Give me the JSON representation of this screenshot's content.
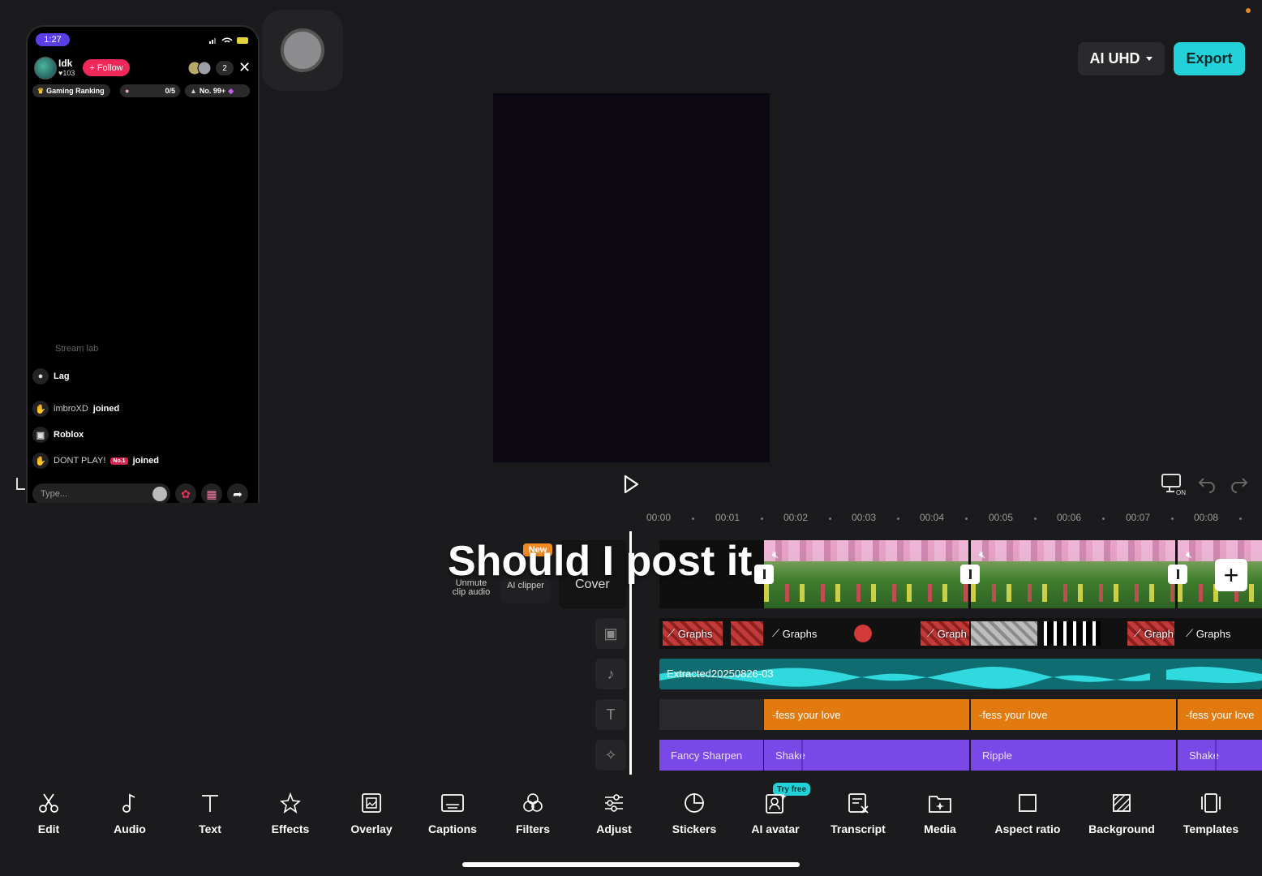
{
  "header": {
    "quality_label": "AI UHD",
    "export_label": "Export"
  },
  "preview": {
    "time_left": "00"
  },
  "phone": {
    "time": "1:27",
    "profile_name": "Idk",
    "likes": "103",
    "follow_label": "+ Follow",
    "viewer_count": "2",
    "ranking_label": "Gaming Ranking",
    "goal_value": "0/5",
    "rank_label": "No. 99+",
    "chat": [
      {
        "name": "Stream lab",
        "text": ""
      },
      {
        "name": "Lag",
        "text": ""
      },
      {
        "name": "imbroXD",
        "text": "joined"
      },
      {
        "name": "Roblox",
        "text": ""
      },
      {
        "name": "DONT PLAY!",
        "badge": "No.1",
        "text": "joined"
      }
    ],
    "input_placeholder": "Type..."
  },
  "timeline": {
    "ruler": [
      "00:00",
      "00:01",
      "00:02",
      "00:03",
      "00:04",
      "00:05",
      "00:06",
      "00:07",
      "00:08"
    ],
    "caption_text": "Should I post it",
    "new_badge": "New",
    "unmute_label": "Unmute\nclip audio",
    "ai_clipper_label": "AI clipper",
    "cover_label": "Cover",
    "overlay_clips": [
      "Graphs",
      "Graphs",
      "Graph",
      "Graph",
      "Graphs"
    ],
    "audio_label": "Extracted20250826-03",
    "text_clips": [
      "-fess your love",
      "-fess your love",
      "-fess your love"
    ],
    "effect_clips": [
      "Fancy Sharpen",
      "Shake",
      "Ripple",
      "Shake"
    ]
  },
  "toolbar": {
    "try_free": "Try free",
    "items": [
      {
        "label": "Edit",
        "icon": "scissors-icon"
      },
      {
        "label": "Audio",
        "icon": "music-note-icon"
      },
      {
        "label": "Text",
        "icon": "text-icon"
      },
      {
        "label": "Effects",
        "icon": "sparkle-icon"
      },
      {
        "label": "Overlay",
        "icon": "overlay-icon"
      },
      {
        "label": "Captions",
        "icon": "captions-icon"
      },
      {
        "label": "Filters",
        "icon": "filters-icon"
      },
      {
        "label": "Adjust",
        "icon": "sliders-icon"
      },
      {
        "label": "Stickers",
        "icon": "sticker-icon"
      },
      {
        "label": "AI avatar",
        "icon": "avatar-icon"
      },
      {
        "label": "Transcript",
        "icon": "transcript-icon"
      },
      {
        "label": "Media",
        "icon": "media-icon"
      },
      {
        "label": "Aspect ratio",
        "icon": "aspect-ratio-icon"
      },
      {
        "label": "Background",
        "icon": "background-icon"
      },
      {
        "label": "Templates",
        "icon": "templates-icon"
      }
    ]
  },
  "colors": {
    "accent": "#23d2d8",
    "text_track": "#e27a10",
    "effect_track": "#7a48e6",
    "audio_track": "#0f6d72",
    "new_badge": "#f08a23",
    "follow": "#f0285a"
  }
}
